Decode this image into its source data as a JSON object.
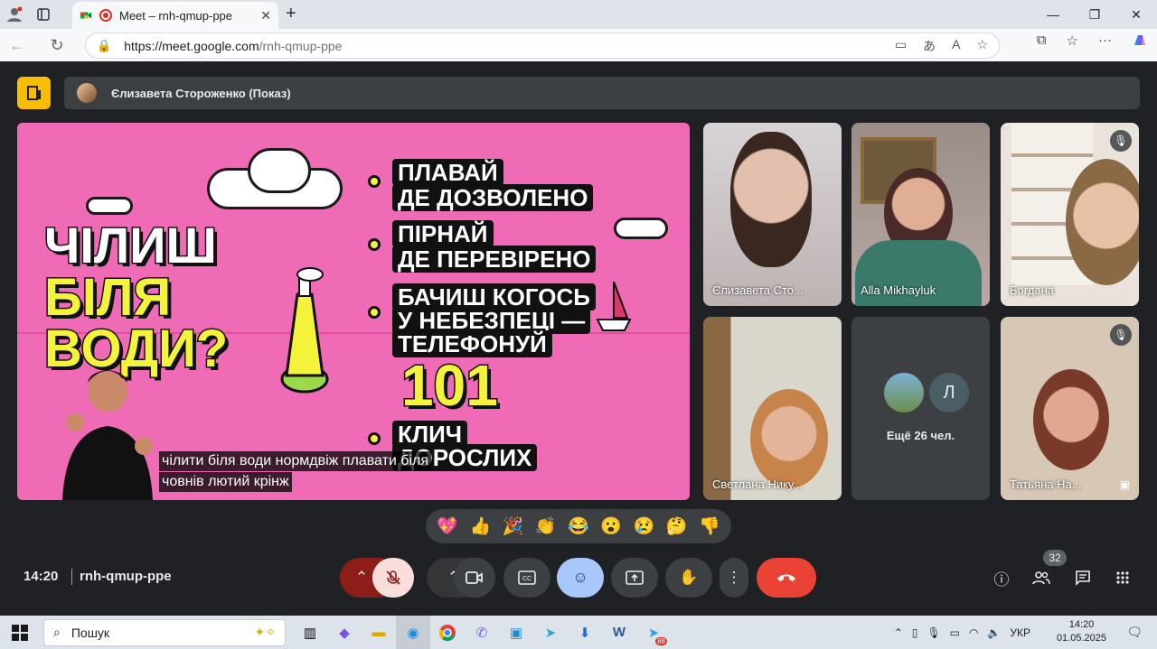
{
  "browser": {
    "tab_title": "Meet – rnh-qmup-ppe",
    "url_host": "https://meet.google.com",
    "url_path": "/rnh-qmup-ppe"
  },
  "meet": {
    "presenter_label": "Єлизавета Стороженко (Показ)",
    "slide": {
      "title_line1": "ЧІЛИШ",
      "title_line2": "БІЛЯ",
      "title_line3": "ВОДИ?",
      "bullet1_line1": "ПЛАВАЙ",
      "bullet1_line2": "ДЕ ДОЗВОЛЕНО",
      "bullet2_line1": "ПІРНАЙ",
      "bullet2_line2": "ДЕ ПЕРЕВІРЕНО",
      "bullet3_line1": "БАЧИШ КОГОСЬ",
      "bullet3_line2": "У НЕБЕЗПЕЦІ —",
      "bullet3_line3": "ТЕЛЕФОНУЙ",
      "bullet3_number": "101",
      "bullet4_line1": "КЛИЧ",
      "bullet4_line2": "ДОРОСЛИХ"
    },
    "captions": {
      "line1": "чілити біля води нормдвіж плавати біля",
      "line2": "човнів лютий крінж"
    },
    "participants": [
      {
        "name": "Єлизавета Сто..."
      },
      {
        "name": "Alla Mikhayluk"
      },
      {
        "name": "Богдана"
      },
      {
        "name": "Светлана Нику..."
      },
      {
        "name": "Татьяна На..."
      }
    ],
    "more": {
      "initial": "Л",
      "label": "Ещё 26 чел."
    },
    "reactions": [
      "💖",
      "👍",
      "🎉",
      "👏",
      "😂",
      "😮",
      "😢",
      "🤔",
      "👎"
    ],
    "time": "14:20",
    "meeting_code": "rnh-qmup-ppe",
    "people_count": "32"
  },
  "taskbar": {
    "search_placeholder": "Пошук",
    "lang": "УКР",
    "time": "14:20",
    "date": "01.05.2025",
    "telegram_badge": "88"
  }
}
